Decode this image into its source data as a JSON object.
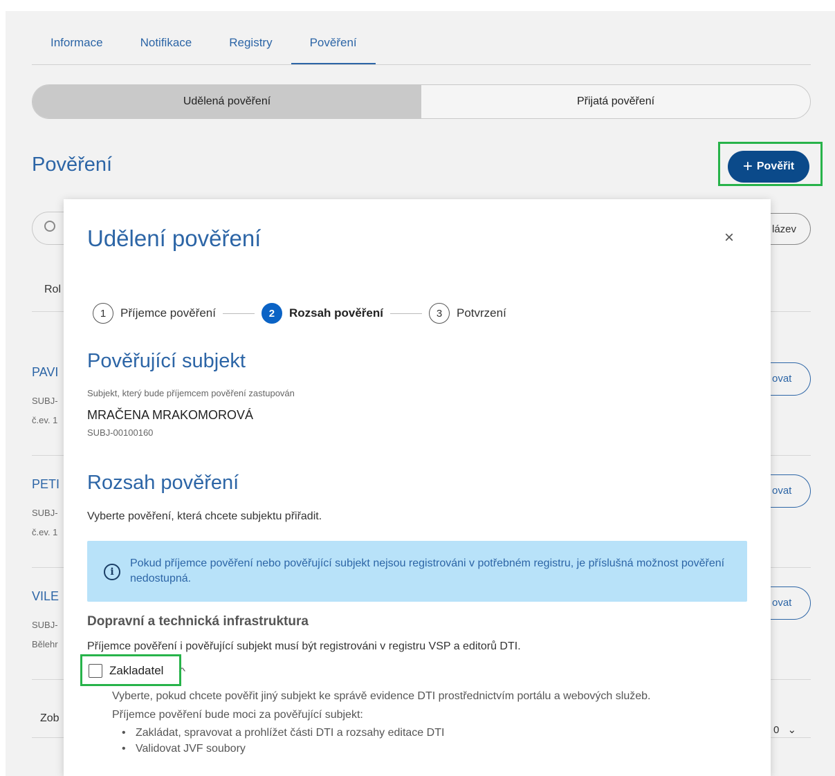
{
  "tabs": [
    {
      "label": "Informace"
    },
    {
      "label": "Notifikace"
    },
    {
      "label": "Registry"
    },
    {
      "label": "Pověření"
    }
  ],
  "segment": {
    "granted": "Udělená pověření",
    "received": "Přijatá pověření"
  },
  "page": {
    "title": "Pověření",
    "add_button": "Pověřit"
  },
  "background": {
    "filter_button": "lázev",
    "col_partial": "Rol",
    "rows": [
      {
        "name": "PAVI",
        "sub1": "SUBJ-",
        "sub2": "č.ev. 1",
        "action": "ovat"
      },
      {
        "name": "PETI",
        "sub1": "SUBJ-",
        "sub2": "č.ev. 1",
        "action": "ovat"
      },
      {
        "name": "VILE",
        "sub1": "SUBJ-",
        "sub2": "Bělehr",
        "action": "ovat"
      }
    ],
    "show_label": "Zob",
    "page_size": "0"
  },
  "modal": {
    "title": "Udělení pověření",
    "steps": [
      {
        "num": "1",
        "label": "Příjemce pověření"
      },
      {
        "num": "2",
        "label": "Rozsah pověření"
      },
      {
        "num": "3",
        "label": "Potvrzení"
      }
    ],
    "subject_section": {
      "title": "Pověřující subjekt",
      "label": "Subjekt, který bude příjemcem pověření zastupován",
      "name": "MRAČENA MRAKOMOROVÁ",
      "id": "SUBJ-00100160"
    },
    "scope_section": {
      "title": "Rozsah pověření",
      "intro": "Vyberte pověření, která chcete subjektu přiřadit.",
      "info": "Pokud příjemce pověření nebo pověřující subjekt nejsou registrováni v potřebném registru, je příslušná možnost pověření nedostupná.",
      "group_title": "Dopravní a technická infrastruktura",
      "group_desc": "Příjemce pověření i pověřující subjekt musí být registrováni v registru VSP a editorů DTI.",
      "checkbox_label": "Zakladatel",
      "checkbox_checked": false,
      "detail1": "Vyberte, pokud chcete pověřit jiný subjekt ke správě evidence DTI prostřednictvím portálu a webových služeb.",
      "detail2": "Příjemce pověření bude moci za pověřující subjekt:",
      "bullets": [
        "Zakládat, spravovat a prohlížet části DTI a rozsahy editace DTI",
        "Validovat JVF soubory"
      ]
    }
  },
  "colors": {
    "primary": "#2c65a6",
    "button": "#0b4a8a",
    "info_bg": "#b8e2f9",
    "highlight": "#27b34a"
  }
}
